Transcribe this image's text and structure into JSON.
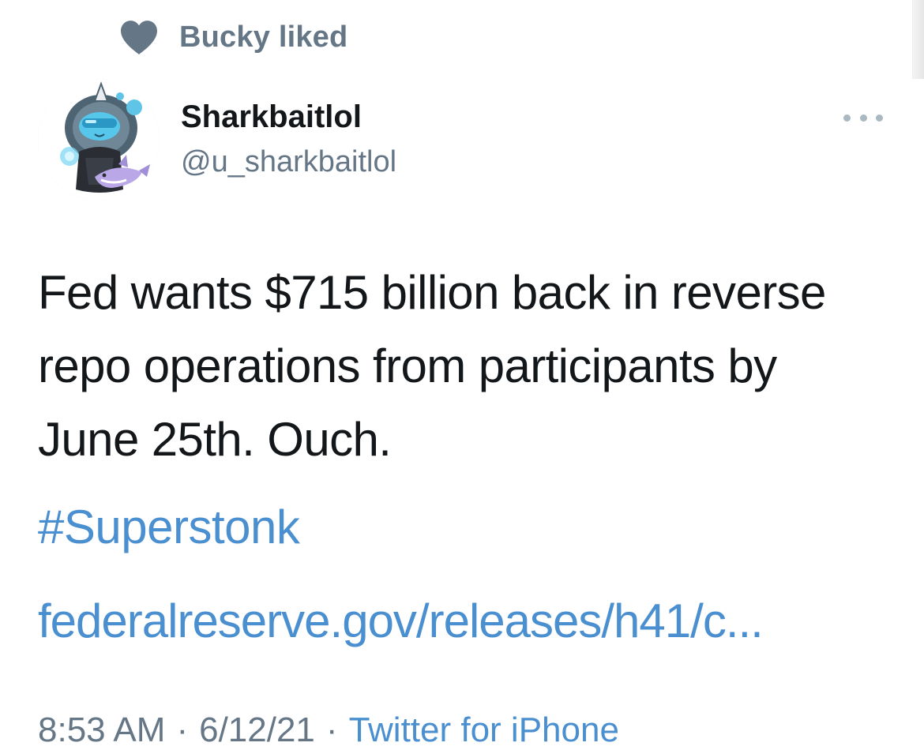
{
  "social_context": {
    "text": "Bucky liked",
    "icon": "heart-icon",
    "icon_color": "#657786"
  },
  "author": {
    "name": "Sharkbaitlol",
    "handle": "@u_sharkbaitlol",
    "avatar": "avatar-cartoon-character-with-shark-plush"
  },
  "more_options": {
    "icon": "more-options-icon"
  },
  "tweet": {
    "lines": [
      "Fed wants $715 billion back in reverse",
      "repo operations from participants by",
      "June 25th. Ouch."
    ],
    "hashtag": "#Superstonk",
    "link": "federalreserve.gov/releases/h41/c..."
  },
  "meta": {
    "time": "8:53 AM",
    "separator": "·",
    "date": "6/12/21",
    "source": "Twitter for iPhone"
  },
  "colors": {
    "text": "#14171a",
    "secondary": "#657786",
    "link": "#4a8fd0"
  }
}
